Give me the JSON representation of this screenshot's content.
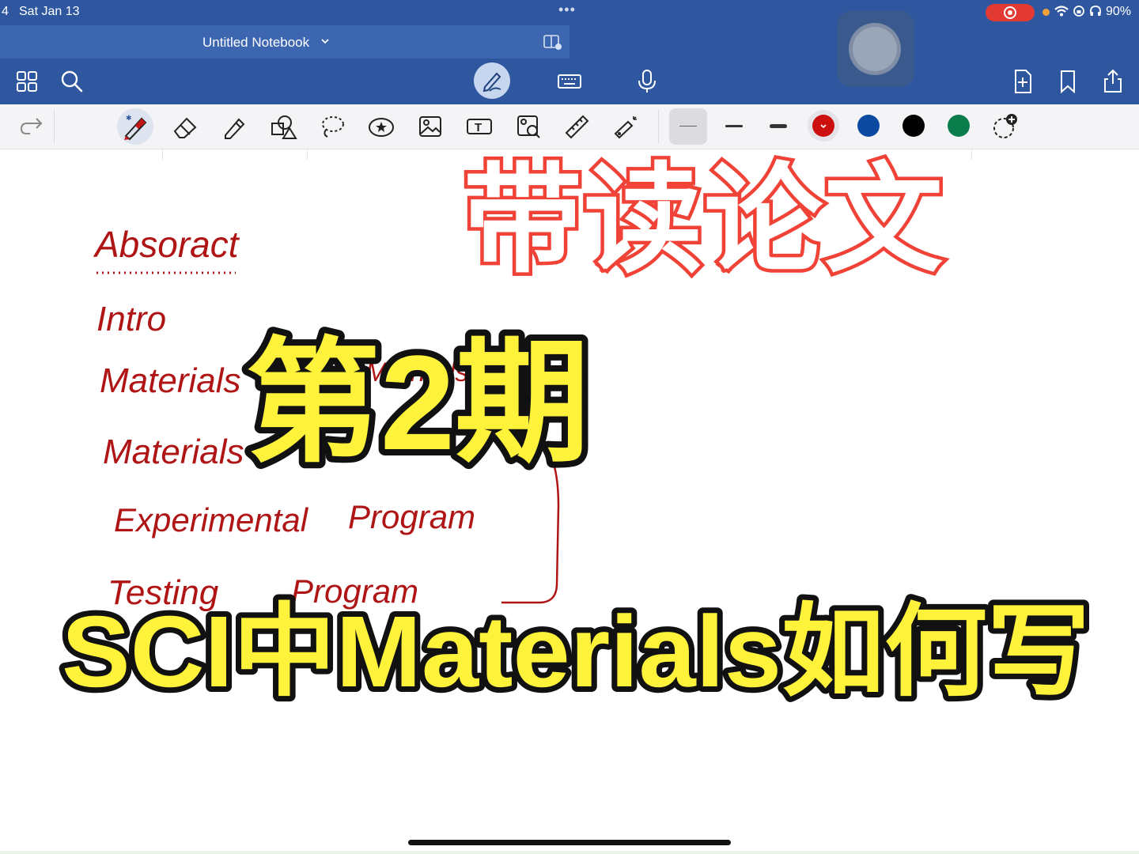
{
  "status_bar": {
    "time": "4",
    "date": "Sat Jan 13",
    "battery": "90%"
  },
  "notebook": {
    "title": "Untitled Notebook"
  },
  "canvas": {
    "handwriting": {
      "abstract": "Absoract",
      "intro": "Intro",
      "materials_1": "Materials",
      "methods": "Methods",
      "materials_2": "Materials",
      "experimental": "Experimental",
      "program_1": "Program",
      "testing": "Testing",
      "program_2": "Program"
    },
    "overlay_title": "带读论文",
    "episode": "第2期",
    "headline": "SCI中Materials如何写"
  },
  "colors": {
    "header_bar": "#2e57a0",
    "pen_red": "#b01515",
    "title_red": "#f04236",
    "headline_yellow": "#fff23a",
    "swatch_red": "#cc0f0f",
    "swatch_blue": "#0b4aa0",
    "swatch_black": "#000000",
    "swatch_green": "#0a7b4b"
  },
  "icons": [
    "grid-icon",
    "search-icon",
    "pen-mode-icon",
    "keyboard-icon",
    "microphone-icon",
    "add-page-icon",
    "bookmark-icon",
    "share-icon",
    "redo-icon",
    "pen-tool-icon",
    "eraser-icon",
    "highlighter-icon",
    "shapes-icon",
    "lasso-icon",
    "sticker-icon",
    "image-icon",
    "textbox-icon",
    "scan-icon",
    "ruler-icon",
    "laser-pointer-icon",
    "add-color-icon"
  ]
}
